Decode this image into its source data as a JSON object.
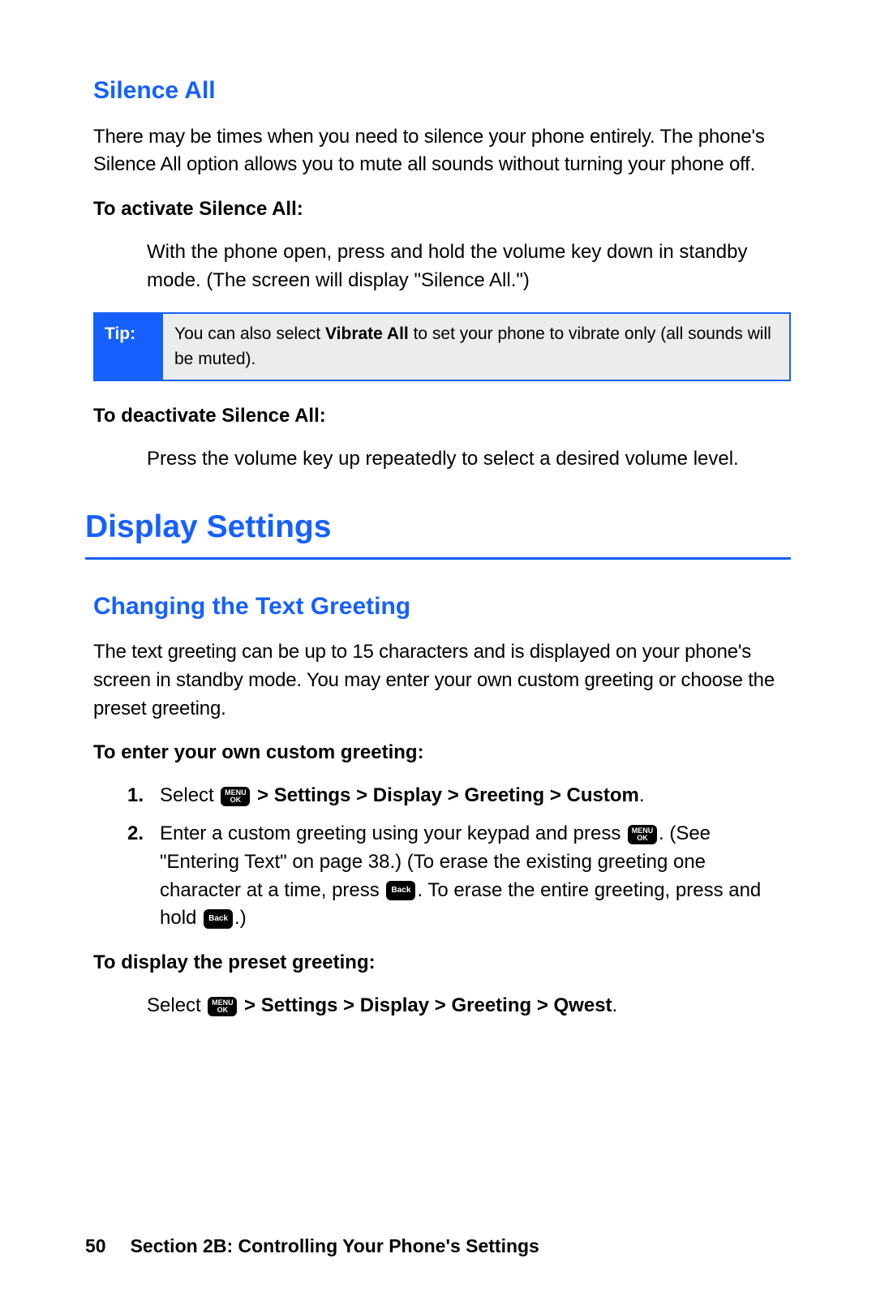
{
  "silence": {
    "heading": "Silence All",
    "intro": "There may be times when you need to silence your phone entirely. The phone's Silence All option allows you to mute all sounds without turning your phone off.",
    "activate_head": "To activate Silence All:",
    "activate_body": "With the phone open, press and hold the volume key down in standby mode. (The screen will display \"Silence All.\")",
    "tip_label": "Tip:",
    "tip_pre": "You can also select ",
    "tip_bold": "Vibrate All",
    "tip_post": " to set your phone to vibrate only (all sounds will be muted).",
    "deactivate_head": "To deactivate Silence All:",
    "deactivate_body": "Press the volume key up repeatedly to select a desired volume level."
  },
  "display": {
    "heading": "Display Settings"
  },
  "greeting": {
    "heading": "Changing the Text Greeting",
    "intro": "The text greeting can be up to 15 characters and is displayed on your phone's screen in standby mode. You may enter your own custom greeting or choose the preset greeting.",
    "custom_head": "To enter your own custom greeting:",
    "step1_pre": "Select ",
    "step1_path": " > Settings > Display > Greeting > Custom",
    "step1_post": ".",
    "step2_a": "Enter a custom greeting using your keypad and press ",
    "step2_b": ". (See \"Entering Text\" on page 38.) (To erase the existing greeting one character at a time, press ",
    "step2_c": ". To erase the entire greeting, press and hold ",
    "step2_d": ".)",
    "preset_head": "To display the preset greeting:",
    "preset_pre": "Select ",
    "preset_path": " > Settings > Display > Greeting > Qwest",
    "preset_post": "."
  },
  "key": {
    "menu": "MENU",
    "ok": "OK",
    "back": "Back"
  },
  "footer": {
    "page": "50",
    "section": "Section 2B: Controlling Your Phone's Settings"
  }
}
